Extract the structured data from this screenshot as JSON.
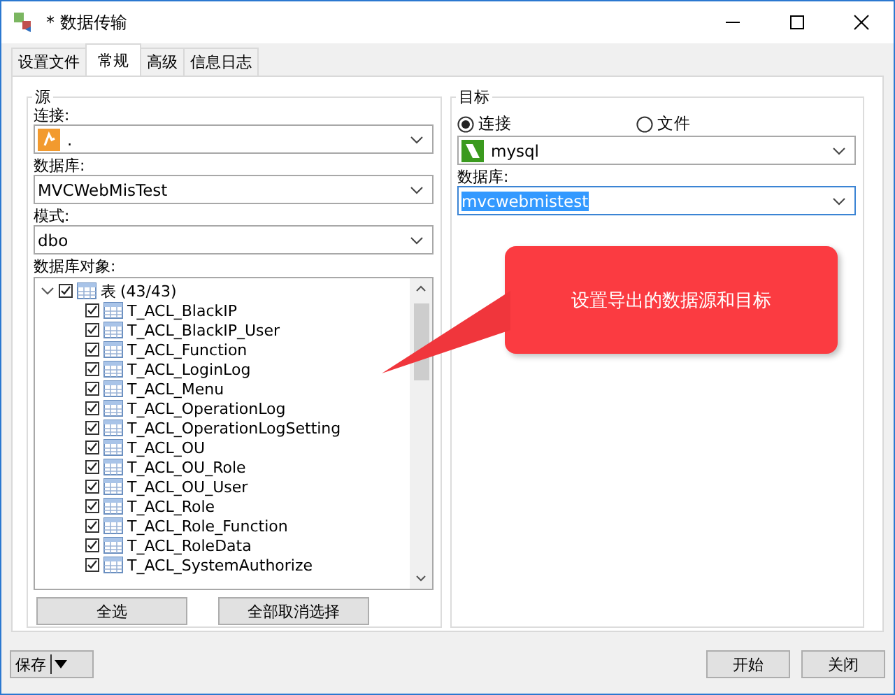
{
  "window": {
    "title": "* 数据传输"
  },
  "tabs": [
    {
      "label": "设置文件",
      "selected": false
    },
    {
      "label": "常规",
      "selected": true
    },
    {
      "label": "高级",
      "selected": false
    },
    {
      "label": "信息日志",
      "selected": false
    }
  ],
  "source": {
    "title": "源",
    "connection": {
      "label": "连接:",
      "value": "."
    },
    "database": {
      "label": "数据库:",
      "value": "MVCWebMisTest"
    },
    "schema": {
      "label": "模式:",
      "value": "dbo"
    },
    "objects": {
      "label": "数据库对象:",
      "root": {
        "label": "表",
        "count": "(43/43)",
        "checked": true,
        "expanded": true,
        "children": [
          {
            "label": "T_ACL_BlackIP",
            "checked": true
          },
          {
            "label": "T_ACL_BlackIP_User",
            "checked": true
          },
          {
            "label": "T_ACL_Function",
            "checked": true
          },
          {
            "label": "T_ACL_LoginLog",
            "checked": true
          },
          {
            "label": "T_ACL_Menu",
            "checked": true
          },
          {
            "label": "T_ACL_OperationLog",
            "checked": true
          },
          {
            "label": "T_ACL_OperationLogSetting",
            "checked": true
          },
          {
            "label": "T_ACL_OU",
            "checked": true
          },
          {
            "label": "T_ACL_OU_Role",
            "checked": true
          },
          {
            "label": "T_ACL_OU_User",
            "checked": true
          },
          {
            "label": "T_ACL_Role",
            "checked": true
          },
          {
            "label": "T_ACL_Role_Function",
            "checked": true
          },
          {
            "label": "T_ACL_RoleData",
            "checked": true
          },
          {
            "label": "T_ACL_SystemAuthorize",
            "checked": true
          }
        ]
      }
    },
    "buttons": [
      "全选",
      "全部取消选择"
    ]
  },
  "target": {
    "title": "目标",
    "modes": [
      {
        "label": "连接",
        "selected": true
      },
      {
        "label": "文件",
        "selected": false
      }
    ],
    "connection": {
      "value": "mysql"
    },
    "database": {
      "label": "数据库:",
      "value": "mvcwebmistest",
      "focused": true
    }
  },
  "callout": {
    "text": "设置导出的数据源和目标"
  },
  "footer": {
    "save": "保存",
    "buttons": [
      "开始",
      "关闭"
    ]
  }
}
